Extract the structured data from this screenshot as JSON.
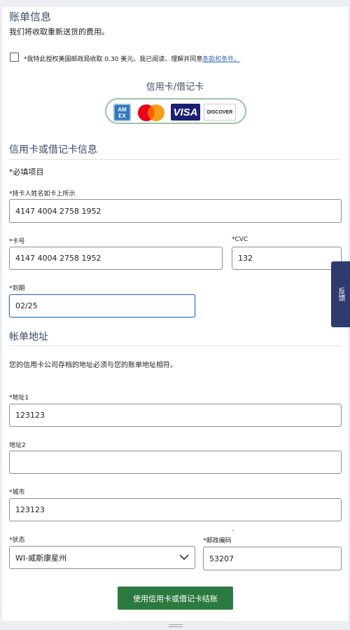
{
  "billing_info": {
    "title": "账单信息",
    "subtitle": "我们将收取重新送货的费用。",
    "consent_text": "*我特此授权美国邮政局收取 0.30 美元。我已阅读、理解并同意",
    "consent_link": "条款和条件。"
  },
  "payment_methods": {
    "title": "信用卡/借记卡",
    "cards": [
      "amex-icon",
      "mastercard-icon",
      "visa-icon",
      "discover-icon"
    ],
    "visa_text": "VISA",
    "discover_text": "DISCOVER",
    "amex_text": "AM EX"
  },
  "card_info": {
    "title": "信用卡或借记卡信息",
    "required_note": "*必填项目",
    "cardholder_label": "*持卡人姓名如卡上所示",
    "cardholder_value": "4147 4004 2758 1952",
    "card_number_label": "*卡号",
    "card_number_value": "4147 4004 2758 1952",
    "cvc_label": "*CVC",
    "cvc_value": "132",
    "expiry_label": "*到期",
    "expiry_value": "02/25"
  },
  "billing_address": {
    "title": "帐单地址",
    "note": "您的信用卡公司存档的地址必须与您的账单地址相符。",
    "address1_label": "*地址1",
    "address1_value": "123123",
    "address2_label": "地址2",
    "address2_value": "",
    "city_label": "*城市",
    "city_value": "123123",
    "state_label": "*状态",
    "state_value": "WI-威斯康星州",
    "zip_label": "*邮政编码",
    "zip_tm": "™",
    "zip_value": "53207"
  },
  "submit_button": "使用信用卡或借记卡结账",
  "feedback_tab": "反馈",
  "colors": {
    "button": "#2b7a3f",
    "feedback": "#2f3a6e",
    "link": "#3b6fc2",
    "section_title": "#3b4a6b"
  }
}
